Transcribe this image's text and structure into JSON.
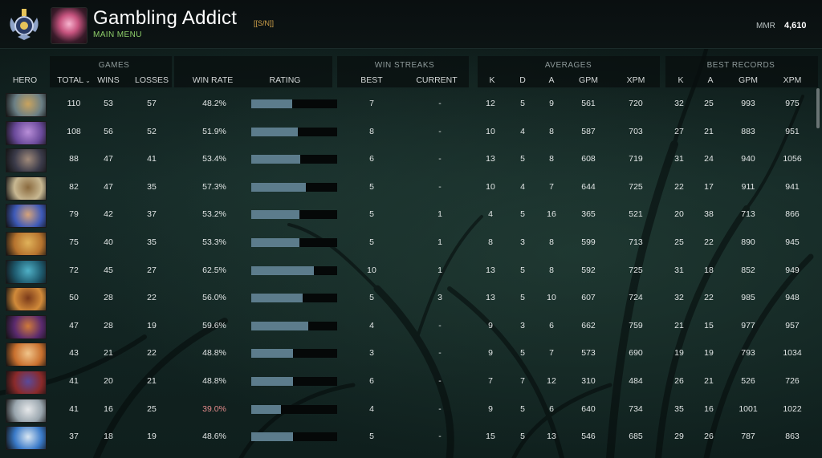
{
  "profile": {
    "name": "Gambling Addict",
    "clan_tag": "[[S/N]]",
    "subtitle": "MAIN MENU",
    "mmr_label": "MMR",
    "mmr_value": "4,610"
  },
  "groups": {
    "games": "GAMES",
    "win_streaks": "WIN STREAKS",
    "averages": "AVERAGES",
    "best_records": "BEST RECORDS"
  },
  "columns": {
    "hero": "HERO",
    "total": "TOTAL",
    "wins": "WINS",
    "losses": "LOSSES",
    "win_rate": "WIN RATE",
    "rating": "RATING",
    "best": "BEST",
    "current": "CURRENT",
    "avg_k": "K",
    "avg_d": "D",
    "avg_a": "A",
    "avg_gpm": "GPM",
    "avg_xpm": "XPM",
    "best_k": "K",
    "best_a": "A",
    "best_gpm": "GPM",
    "best_xpm": "XPM"
  },
  "colors": {
    "rating_fill": "#5c7c8c",
    "low_win_rate": "#e58b8b",
    "subtitle": "#8fcf6a"
  },
  "rows": [
    {
      "hero_icon": "hero-portrait-1",
      "colors": [
        "#6b7f85",
        "#c9a35e"
      ],
      "total": "110",
      "wins": "53",
      "losses": "57",
      "win_rate": "48.2%",
      "rating": 0.48,
      "best": "7",
      "current": "-",
      "k": "12",
      "d": "5",
      "a": "9",
      "gpm": "561",
      "xpm": "720",
      "bk": "32",
      "ba": "25",
      "bgpm": "993",
      "bxpm": "975"
    },
    {
      "hero_icon": "hero-portrait-2",
      "colors": [
        "#6a4a9a",
        "#b88ed8"
      ],
      "total": "108",
      "wins": "56",
      "losses": "52",
      "win_rate": "51.9%",
      "rating": 0.54,
      "best": "8",
      "current": "-",
      "k": "10",
      "d": "4",
      "a": "8",
      "gpm": "587",
      "xpm": "703",
      "bk": "27",
      "ba": "21",
      "bgpm": "883",
      "bxpm": "951"
    },
    {
      "hero_icon": "hero-portrait-3",
      "colors": [
        "#3b3b4a",
        "#a08a7a"
      ],
      "total": "88",
      "wins": "47",
      "losses": "41",
      "win_rate": "53.4%",
      "rating": 0.57,
      "best": "6",
      "current": "-",
      "k": "13",
      "d": "5",
      "a": "8",
      "gpm": "608",
      "xpm": "719",
      "bk": "31",
      "ba": "24",
      "bgpm": "940",
      "bxpm": "1056"
    },
    {
      "hero_icon": "hero-portrait-4",
      "colors": [
        "#c8b892",
        "#8a6a3e"
      ],
      "total": "82",
      "wins": "47",
      "losses": "35",
      "win_rate": "57.3%",
      "rating": 0.64,
      "best": "5",
      "current": "-",
      "k": "10",
      "d": "4",
      "a": "7",
      "gpm": "644",
      "xpm": "725",
      "bk": "22",
      "ba": "17",
      "bgpm": "911",
      "bxpm": "941"
    },
    {
      "hero_icon": "hero-portrait-5",
      "colors": [
        "#3e5ab8",
        "#d6a37a"
      ],
      "total": "79",
      "wins": "42",
      "losses": "37",
      "win_rate": "53.2%",
      "rating": 0.56,
      "best": "5",
      "current": "1",
      "k": "4",
      "d": "5",
      "a": "16",
      "gpm": "365",
      "xpm": "521",
      "bk": "20",
      "ba": "38",
      "bgpm": "713",
      "bxpm": "866"
    },
    {
      "hero_icon": "hero-portrait-6",
      "colors": [
        "#b5732e",
        "#e0b25a"
      ],
      "total": "75",
      "wins": "40",
      "losses": "35",
      "win_rate": "53.3%",
      "rating": 0.56,
      "best": "5",
      "current": "1",
      "k": "8",
      "d": "3",
      "a": "8",
      "gpm": "599",
      "xpm": "713",
      "bk": "25",
      "ba": "22",
      "bgpm": "890",
      "bxpm": "945"
    },
    {
      "hero_icon": "hero-portrait-7",
      "colors": [
        "#1e5a6e",
        "#4fb0c6"
      ],
      "total": "72",
      "wins": "45",
      "losses": "27",
      "win_rate": "62.5%",
      "rating": 0.73,
      "best": "10",
      "current": "1",
      "k": "13",
      "d": "5",
      "a": "8",
      "gpm": "592",
      "xpm": "725",
      "bk": "31",
      "ba": "18",
      "bgpm": "852",
      "bxpm": "949"
    },
    {
      "hero_icon": "hero-portrait-8",
      "colors": [
        "#d18a3a",
        "#7a3a1a"
      ],
      "total": "50",
      "wins": "28",
      "losses": "22",
      "win_rate": "56.0%",
      "rating": 0.6,
      "best": "5",
      "current": "3",
      "k": "13",
      "d": "5",
      "a": "10",
      "gpm": "607",
      "xpm": "724",
      "bk": "32",
      "ba": "22",
      "bgpm": "985",
      "bxpm": "948"
    },
    {
      "hero_icon": "hero-portrait-9",
      "colors": [
        "#5a2a6e",
        "#d07a3a"
      ],
      "total": "47",
      "wins": "28",
      "losses": "19",
      "win_rate": "59.6%",
      "rating": 0.66,
      "best": "4",
      "current": "-",
      "k": "9",
      "d": "3",
      "a": "6",
      "gpm": "662",
      "xpm": "759",
      "bk": "21",
      "ba": "15",
      "bgpm": "977",
      "bxpm": "957"
    },
    {
      "hero_icon": "hero-portrait-10",
      "colors": [
        "#c8702e",
        "#f0c48a"
      ],
      "total": "43",
      "wins": "21",
      "losses": "22",
      "win_rate": "48.8%",
      "rating": 0.49,
      "best": "3",
      "current": "-",
      "k": "9",
      "d": "5",
      "a": "7",
      "gpm": "573",
      "xpm": "690",
      "bk": "19",
      "ba": "19",
      "bgpm": "793",
      "bxpm": "1034"
    },
    {
      "hero_icon": "hero-portrait-11",
      "colors": [
        "#8a2a2a",
        "#5a4a9a"
      ],
      "total": "41",
      "wins": "20",
      "losses": "21",
      "win_rate": "48.8%",
      "rating": 0.49,
      "best": "6",
      "current": "-",
      "k": "7",
      "d": "7",
      "a": "12",
      "gpm": "310",
      "xpm": "484",
      "bk": "26",
      "ba": "21",
      "bgpm": "526",
      "bxpm": "726"
    },
    {
      "hero_icon": "hero-portrait-12",
      "colors": [
        "#9aa6ae",
        "#e6e8ea"
      ],
      "total": "41",
      "wins": "16",
      "losses": "25",
      "win_rate": "39.0%",
      "rating": 0.35,
      "best": "4",
      "current": "-",
      "k": "9",
      "d": "5",
      "a": "6",
      "gpm": "640",
      "xpm": "734",
      "bk": "35",
      "ba": "16",
      "bgpm": "1001",
      "bxpm": "1022",
      "low": true
    },
    {
      "hero_icon": "hero-portrait-13",
      "colors": [
        "#3a7ac8",
        "#d8e6f2"
      ],
      "total": "37",
      "wins": "18",
      "losses": "19",
      "win_rate": "48.6%",
      "rating": 0.49,
      "best": "5",
      "current": "-",
      "k": "15",
      "d": "5",
      "a": "13",
      "gpm": "546",
      "xpm": "685",
      "bk": "29",
      "ba": "26",
      "bgpm": "787",
      "bxpm": "863"
    }
  ]
}
